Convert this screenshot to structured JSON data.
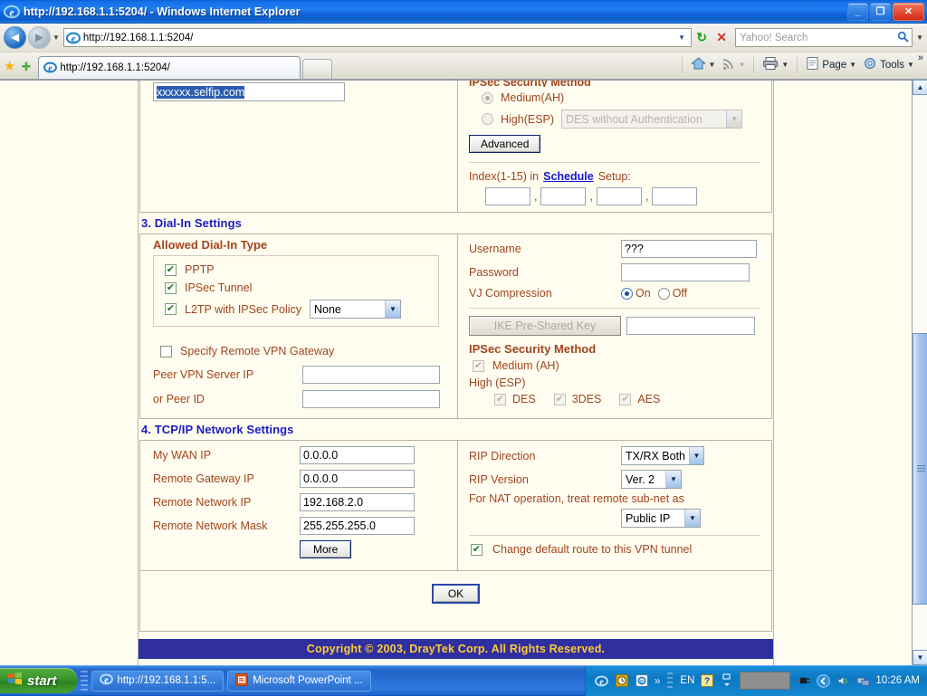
{
  "window": {
    "title": "http://192.168.1.1:5204/ - Windows Internet Explorer",
    "minimize_label": "_",
    "maximize_label": "❐",
    "close_label": "✕",
    "icon": "ie-logo-icon"
  },
  "browser": {
    "back_label": "◄",
    "forward_label": "►",
    "nav_dropdown_label": "▼",
    "address_value": "http://192.168.1.1:5204/",
    "address_dropdown_label": "▼",
    "refresh_label": "↻",
    "stop_label": "✕",
    "search_placeholder": "Yahoo! Search",
    "search_go_label": "🔍",
    "search_dropdown_label": "▼",
    "favorites_star_label": "★",
    "add_favorite_label": "✚",
    "tab_label": "http://192.168.1.1:5204/",
    "new_tab_label": "",
    "overflow_label": "»",
    "commands": [
      {
        "name": "home",
        "label": "",
        "icon": "home-icon",
        "has_arrow": true
      },
      {
        "name": "feeds",
        "label": "",
        "icon": "rss-icon",
        "has_arrow": true
      },
      {
        "name": "print",
        "label": "",
        "icon": "printer-icon",
        "has_arrow": true
      },
      {
        "name": "page",
        "label": "Page",
        "icon": "page-icon",
        "has_arrow": true
      },
      {
        "name": "tools",
        "label": "Tools",
        "icon": "gear-icon",
        "has_arrow": true
      }
    ]
  },
  "page": {
    "top_partial": {
      "domain_field_value": "xxxxxx.selfip.com",
      "ipsec_security_method_title": "IPSec Security Method",
      "medium_label": "Medium(AH)",
      "medium_selected": true,
      "high_label": "High(ESP)",
      "high_selected": false,
      "high_select_value": "DES without Authentication",
      "advanced_button": "Advanced",
      "schedule_prefix": "Index(1-15) in",
      "schedule_link": "Schedule",
      "schedule_suffix": "Setup:",
      "schedule_values": [
        "",
        "",
        "",
        ""
      ],
      "schedule_separator": ","
    },
    "section3": {
      "title": "3. Dial-In Settings",
      "allowed_dialin_title": "Allowed Dial-In Type",
      "dialin_types": [
        {
          "label": "PPTP",
          "checked": true
        },
        {
          "label": "IPSec Tunnel",
          "checked": true
        },
        {
          "label": "L2TP with IPSec Policy",
          "checked": true,
          "select_value": "None"
        }
      ],
      "specify_gateway_label": "Specify Remote VPN Gateway",
      "specify_gateway_checked": false,
      "peer_vpn_server_ip_label": "Peer VPN Server IP",
      "peer_vpn_server_ip_value": "",
      "peer_id_label": "or Peer ID",
      "peer_id_value": "",
      "username_label": "Username",
      "username_value": "???",
      "password_label": "Password",
      "password_value": "",
      "vj_compression_label": "VJ Compression",
      "vj_on_label": "On",
      "vj_off_label": "Off",
      "vj_selected": "On",
      "ike_psk_button": "IKE Pre-Shared Key",
      "ike_psk_value": "",
      "ipsec_security_method_title": "IPSec Security Method",
      "medium_ah_label": "Medium (AH)",
      "medium_ah_checked": true,
      "high_esp_label": "High (ESP)",
      "esp_options": [
        {
          "label": "DES",
          "checked": true
        },
        {
          "label": "3DES",
          "checked": true
        },
        {
          "label": "AES",
          "checked": true
        }
      ]
    },
    "section4": {
      "title": "4. TCP/IP Network Settings",
      "fields": [
        {
          "label": "My WAN IP",
          "value": "0.0.0.0"
        },
        {
          "label": "Remote Gateway IP",
          "value": "0.0.0.0"
        },
        {
          "label": "Remote Network IP",
          "value": "192.168.2.0"
        },
        {
          "label": "Remote Network Mask",
          "value": "255.255.255.0"
        }
      ],
      "more_button": "More",
      "rip_direction_label": "RIP Direction",
      "rip_direction_value": "TX/RX Both",
      "rip_version_label": "RIP Version",
      "rip_version_value": "Ver. 2",
      "nat_note": "For NAT operation, treat remote sub-net as",
      "nat_value": "Public IP",
      "change_route_label": "Change default route to this VPN tunnel",
      "change_route_checked": true
    },
    "ok_button": "OK",
    "copyright": "Copyright © 2003, DrayTek Corp. All Rights Reserved."
  },
  "scrollbar": {
    "up_label": "▲",
    "down_label": "▼"
  },
  "taskbar": {
    "start_label": "start",
    "tasks": [
      {
        "label": "http://192.168.1.1:5...",
        "icon": "ie-logo-icon"
      },
      {
        "label": "Microsoft PowerPoint ...",
        "icon": "powerpoint-icon"
      }
    ],
    "tray_overflow_label": "»",
    "language_label": "EN",
    "clock": "10:26 AM"
  },
  "colors": {
    "page_bg": "#fffdf0",
    "section_title": "#1b1bc0",
    "label_text": "#a0451d",
    "copyright_bar": "#2f2f9f",
    "copyright_text": "#ffcc33",
    "link": "#1414d2",
    "selection_bg": "#2a5db0"
  }
}
